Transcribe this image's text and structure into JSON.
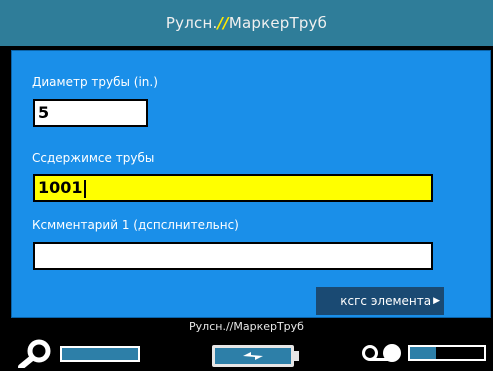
{
  "title": {
    "prefix": "Рулсн.",
    "accent": "//",
    "suffix": "МаркерТруб"
  },
  "fields": [
    {
      "label": "Диаметр трубы (in.)",
      "value": "5"
    },
    {
      "label": "Ссдержимсе трубы",
      "value": "1001"
    },
    {
      "label": "Ксмментарий 1 (дспслнительнс)",
      "value": ""
    }
  ],
  "next_button": {
    "label": "ксгс элемента"
  },
  "status": {
    "caption": "Рулсн.//МаркерТруб",
    "search_icon": "magnifier-icon",
    "battery_icon": "battery-icon",
    "battery_symbol": "charging-bolt-icon",
    "tape_icon": "tape-reel-icon",
    "tape_level": 0.35
  },
  "colors": {
    "titlebar": "#2f7d99",
    "panel": "#1a8fe9",
    "active_field": "#ffff00",
    "button": "#1a4a73"
  }
}
